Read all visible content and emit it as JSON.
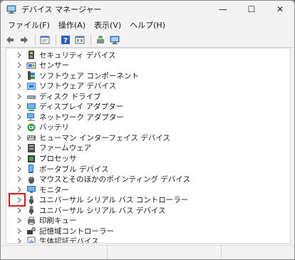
{
  "window": {
    "title": "デバイス マネージャー",
    "controls": {
      "minimize": "—",
      "maximize": "☐",
      "close": "✕"
    }
  },
  "menu": {
    "items": [
      "ファイル(F)",
      "操作(A)",
      "表示(V)",
      "ヘルプ(H)"
    ]
  },
  "toolbar": {
    "buttons": [
      "back-icon",
      "forward-icon",
      "properties-icon",
      "help-icon",
      "show-hidden-icon",
      "update-driver-icon",
      "scan-hardware-icon"
    ]
  },
  "tree": {
    "items": [
      {
        "label": "セキュリティ デバイス",
        "icon": "security-device-icon"
      },
      {
        "label": "センサー",
        "icon": "sensor-icon"
      },
      {
        "label": "ソフトウェア コンポーネント",
        "icon": "software-component-icon"
      },
      {
        "label": "ソフトウェア デバイス",
        "icon": "software-device-icon"
      },
      {
        "label": "ディスク ドライブ",
        "icon": "disk-drive-icon"
      },
      {
        "label": "ディスプレイ アダプター",
        "icon": "display-adapter-icon"
      },
      {
        "label": "ネットワーク アダプター",
        "icon": "network-adapter-icon"
      },
      {
        "label": "バッテリ",
        "icon": "battery-icon"
      },
      {
        "label": "ヒューマン インターフェイス デバイス",
        "icon": "hid-icon"
      },
      {
        "label": "ファームウェア",
        "icon": "firmware-icon"
      },
      {
        "label": "プロセッサ",
        "icon": "processor-icon"
      },
      {
        "label": "ポータブル デバイス",
        "icon": "portable-device-icon"
      },
      {
        "label": "マウスとそのほかのポインティング デバイス",
        "icon": "mouse-icon"
      },
      {
        "label": "モニター",
        "icon": "monitor-icon"
      },
      {
        "label": "ユニバーサル シリアル バス コントローラー",
        "icon": "usb-controller-icon"
      },
      {
        "label": "ユニバーサル シリアル バス デバイス",
        "icon": "usb-device-icon"
      },
      {
        "label": "印刷キュー",
        "icon": "print-queue-icon"
      },
      {
        "label": "記憶域コントローラー",
        "icon": "storage-controller-icon"
      },
      {
        "label": "生体認証デバイス",
        "icon": "biometric-icon"
      }
    ],
    "highlighted_index": 14
  },
  "colors": {
    "highlight": "#e0151b",
    "window_bg": "#f3f3f3",
    "tree_bg": "#ffffff"
  }
}
